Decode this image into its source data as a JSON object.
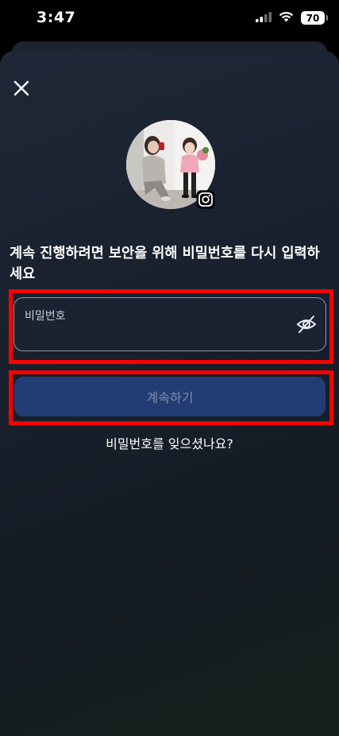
{
  "status_bar": {
    "time": "3:47",
    "battery": "70",
    "icons": [
      "signal-icon",
      "wifi-icon",
      "battery-icon"
    ]
  },
  "close_icon": "close-icon",
  "avatar": {
    "badge_icon": "instagram-icon"
  },
  "prompt": "계속 진행하려면 보안을 위해 비밀번호를 다시 입력하세요",
  "password_field": {
    "label": "비밀번호",
    "value": "",
    "toggle_icon": "eye-off-icon"
  },
  "continue_label": "계속하기",
  "forgot_label": "비밀번호를 잊으셨나요?",
  "colors": {
    "highlight": "#ff0000",
    "button_bg": "#223d74",
    "button_text": "#7f8ea8",
    "sheet_bg": "#1a2230"
  }
}
